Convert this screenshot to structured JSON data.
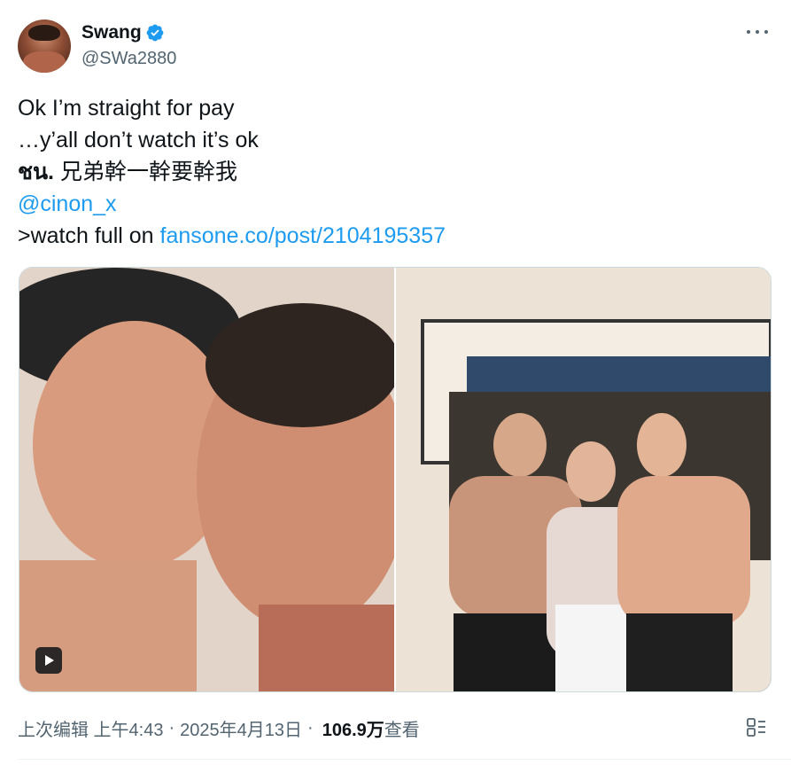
{
  "author": {
    "display_name": "Swang",
    "handle": "@SWa2880",
    "verified": true
  },
  "tweet": {
    "line1": "Ok I’m straight for pay",
    "line2": "…y’all don’t watch it’s ok",
    "line3_thai": "ชน.",
    "line3_cn": " 兄弟幹一幹要幹我",
    "mention": "@cinon_x",
    "line5_prefix": ">watch full on ",
    "line5_link": "fansone.co/post/2104195357"
  },
  "media": {
    "items": [
      {
        "type": "video",
        "icon": "play-icon"
      },
      {
        "type": "photo"
      }
    ]
  },
  "footer": {
    "edited_time": "上次编辑 上午4:43",
    "sep1": "·",
    "date": "2025年4月13日",
    "sep2": "·",
    "views_count": "106.9万",
    "views_label": " 查看"
  },
  "colors": {
    "link": "#1d9bf0",
    "muted": "#536471",
    "text": "#0f1419",
    "verified": "#1d9bf0"
  },
  "icons": {
    "more": "more-icon",
    "analytics": "analytics-icon",
    "verified": "verified-badge-icon"
  }
}
